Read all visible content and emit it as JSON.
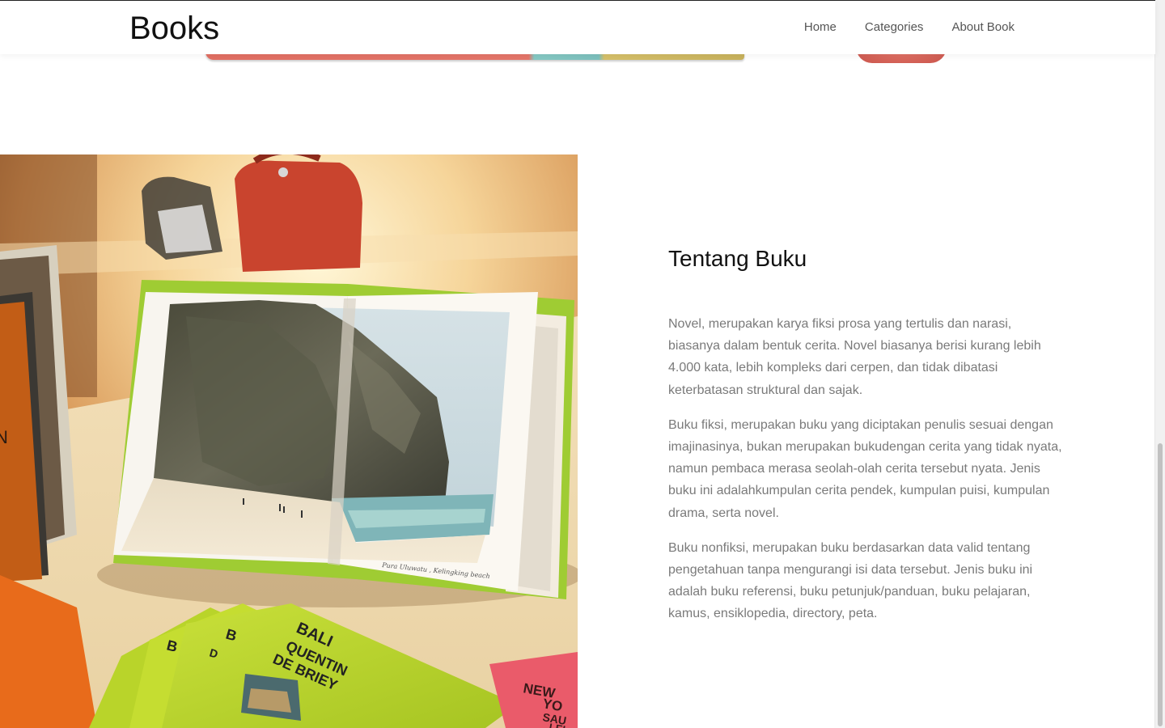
{
  "navbar": {
    "brand": "Books",
    "links": [
      {
        "label": "Home"
      },
      {
        "label": "Categories"
      },
      {
        "label": "About Book"
      }
    ]
  },
  "about": {
    "title": "Tentang Buku",
    "paragraphs": [
      "Novel, merupakan karya fiksi prosa yang tertulis dan narasi, biasanya dalam bentuk cerita. Novel biasanya berisi kurang lebih 4.000 kata, lebih kompleks dari cerpen, dan tidak dibatasi keterbatasan struktural dan sajak.",
      "Buku fiksi, merupakan buku yang diciptakan penulis sesuai dengan imajinasinya, bukan merupakan bukudengan cerita yang tidak nyata, namun pembaca merasa seolah-olah cerita tersebut nyata. Jenis buku ini adalahkumpulan cerita pendek, kumpulan puisi, kumpulan drama, serta novel.",
      "Buku nonfiksi, merupakan buku berdasarkan data valid tentang pengetahuan tanpa mengurangi isi data tersebut. Jenis buku ini adalah buku referensi, buku petunjuk/panduan, buku pelajaran, kamus, ensiklopedia, directory, peta."
    ]
  },
  "photo": {
    "book_cover_lines": [
      "BALI",
      "QUENTIN",
      "DE BRIEY"
    ],
    "book_partial": [
      "B",
      "B",
      "D"
    ],
    "spine_letter": "N",
    "pink_book_lines": [
      "NEW",
      "YO",
      "SAU",
      "LEI"
    ],
    "caption": "Pura Uluwatu , Kelingking beach"
  }
}
